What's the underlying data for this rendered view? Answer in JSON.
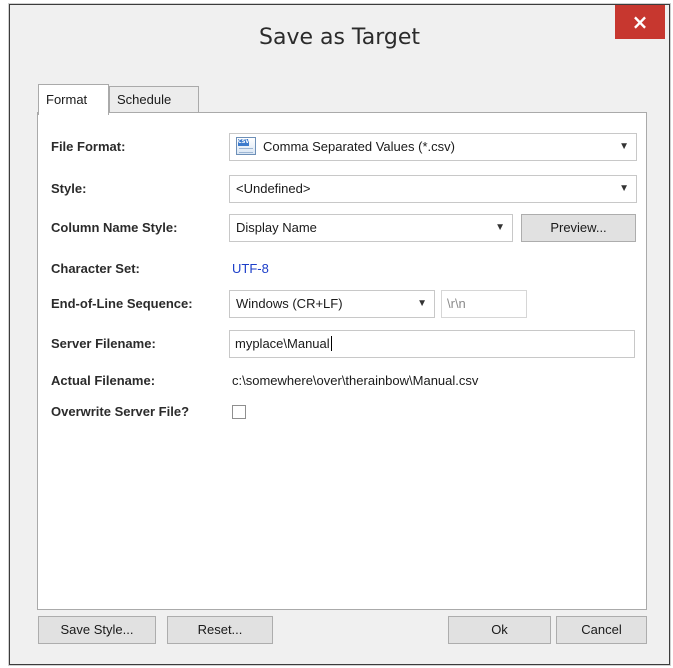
{
  "window": {
    "title": "Save as Target",
    "close_label": "×"
  },
  "tabs": [
    {
      "label": "Format",
      "active": true
    },
    {
      "label": "Schedule",
      "active": false
    }
  ],
  "form": {
    "file_format": {
      "label": "File Format:",
      "value": "Comma Separated Values (*.csv)",
      "icon": "csv-file-icon",
      "icon_tag": "CSV"
    },
    "style": {
      "label": "Style:",
      "value": "<Undefined>"
    },
    "column_name_style": {
      "label": "Column Name Style:",
      "value": "Display Name",
      "preview_label": "Preview..."
    },
    "character_set": {
      "label": "Character Set:",
      "value": "UTF-8",
      "color": "#1c3ec9"
    },
    "end_of_line": {
      "label": "End-of-Line Sequence:",
      "value": "Windows (CR+LF)",
      "escape_value": "\\r\\n"
    },
    "server_filename": {
      "label": "Server Filename:",
      "value": "myplace\\Manual"
    },
    "actual_filename": {
      "label": "Actual Filename:",
      "value": "c:\\somewhere\\over\\therainbow\\Manual.csv"
    },
    "overwrite": {
      "label": "Overwrite Server File?",
      "checked": false
    }
  },
  "footer": {
    "save_style_label": "Save Style...",
    "reset_label": "Reset...",
    "ok_label": "Ok",
    "cancel_label": "Cancel"
  },
  "colors": {
    "close_button": "#c7372f",
    "link_blue": "#1c3ec9",
    "window_bg": "#f0f0f0"
  },
  "dropdown_arrow": "▼"
}
